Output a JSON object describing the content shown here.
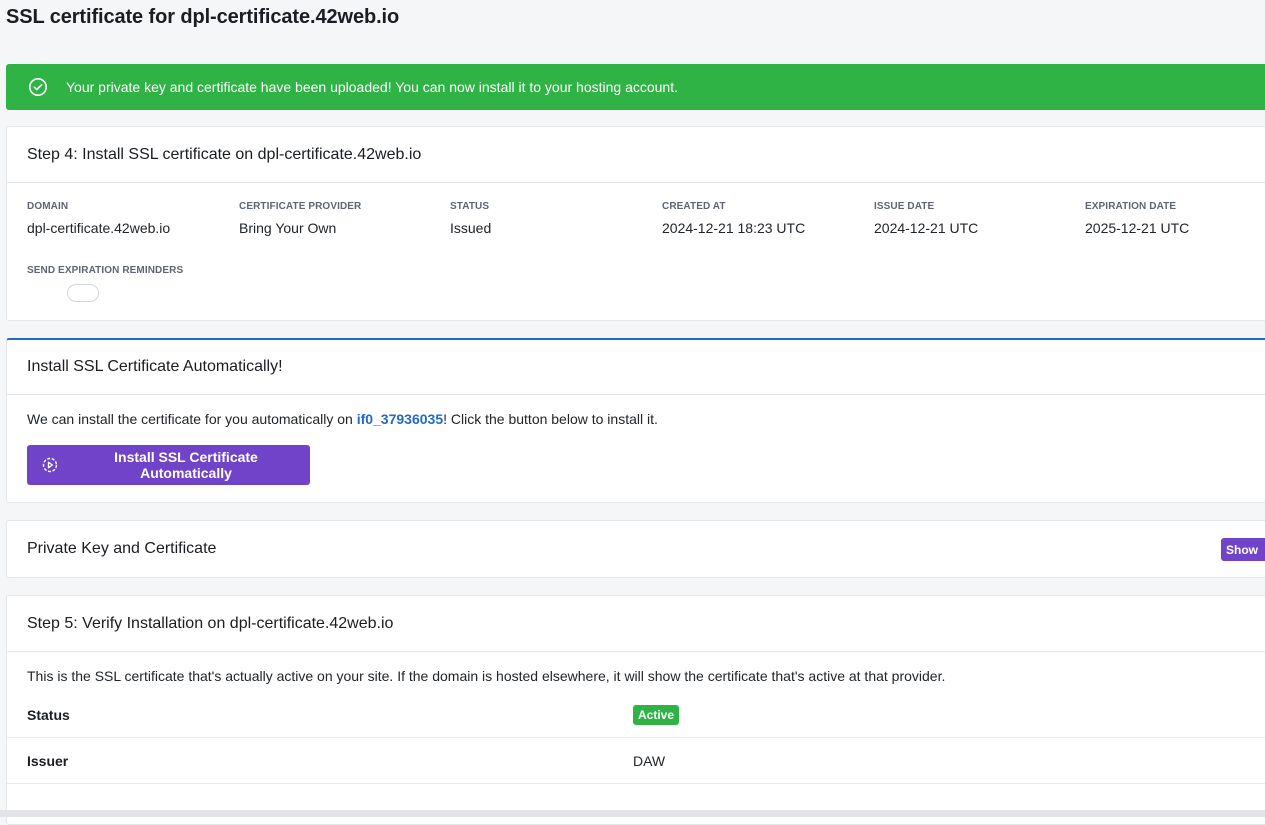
{
  "page": {
    "title": "SSL certificate for dpl-certificate.42web.io"
  },
  "alert": {
    "message": "Your private key and certificate have been uploaded! You can now install it to your hosting account.",
    "icon": "check-circle-icon",
    "color": "#2fb344"
  },
  "step4": {
    "title": "Step 4: Install SSL certificate on dpl-certificate.42web.io",
    "fields": [
      {
        "label": "DOMAIN",
        "value": "dpl-certificate.42web.io"
      },
      {
        "label": "CERTIFICATE PROVIDER",
        "value": "Bring Your Own"
      },
      {
        "label": "STATUS",
        "value": "Issued"
      },
      {
        "label": "CREATED AT",
        "value": "2024-12-21 18:23 UTC"
      },
      {
        "label": "ISSUE DATE",
        "value": "2024-12-21 UTC"
      },
      {
        "label": "EXPIRATION DATE",
        "value": "2025-12-21 UTC"
      }
    ],
    "reminders_label": "SEND EXPIRATION REMINDERS",
    "reminders_enabled": false
  },
  "auto_install": {
    "title": "Install SSL Certificate Automatically!",
    "text_before": "We can install the certificate for you automatically on ",
    "account_link": "if0_37936035",
    "text_after": "! Click the button below to install it.",
    "button_label": "Install SSL Certificate Automatically",
    "button_icon": "gear-play-icon",
    "accent_color": "#206bc4",
    "button_color": "#7043c8"
  },
  "private_key": {
    "title": "Private Key and Certificate",
    "show_button": "Show"
  },
  "step5": {
    "title": "Step 5: Verify Installation on dpl-certificate.42web.io",
    "description": "This is the SSL certificate that's actually active on your site. If the domain is hosted elsewhere, it will show the certificate that's active at that provider.",
    "rows": [
      {
        "key": "Status",
        "value": "Active",
        "badge": true
      },
      {
        "key": "Issuer",
        "value": "DAW"
      }
    ]
  }
}
